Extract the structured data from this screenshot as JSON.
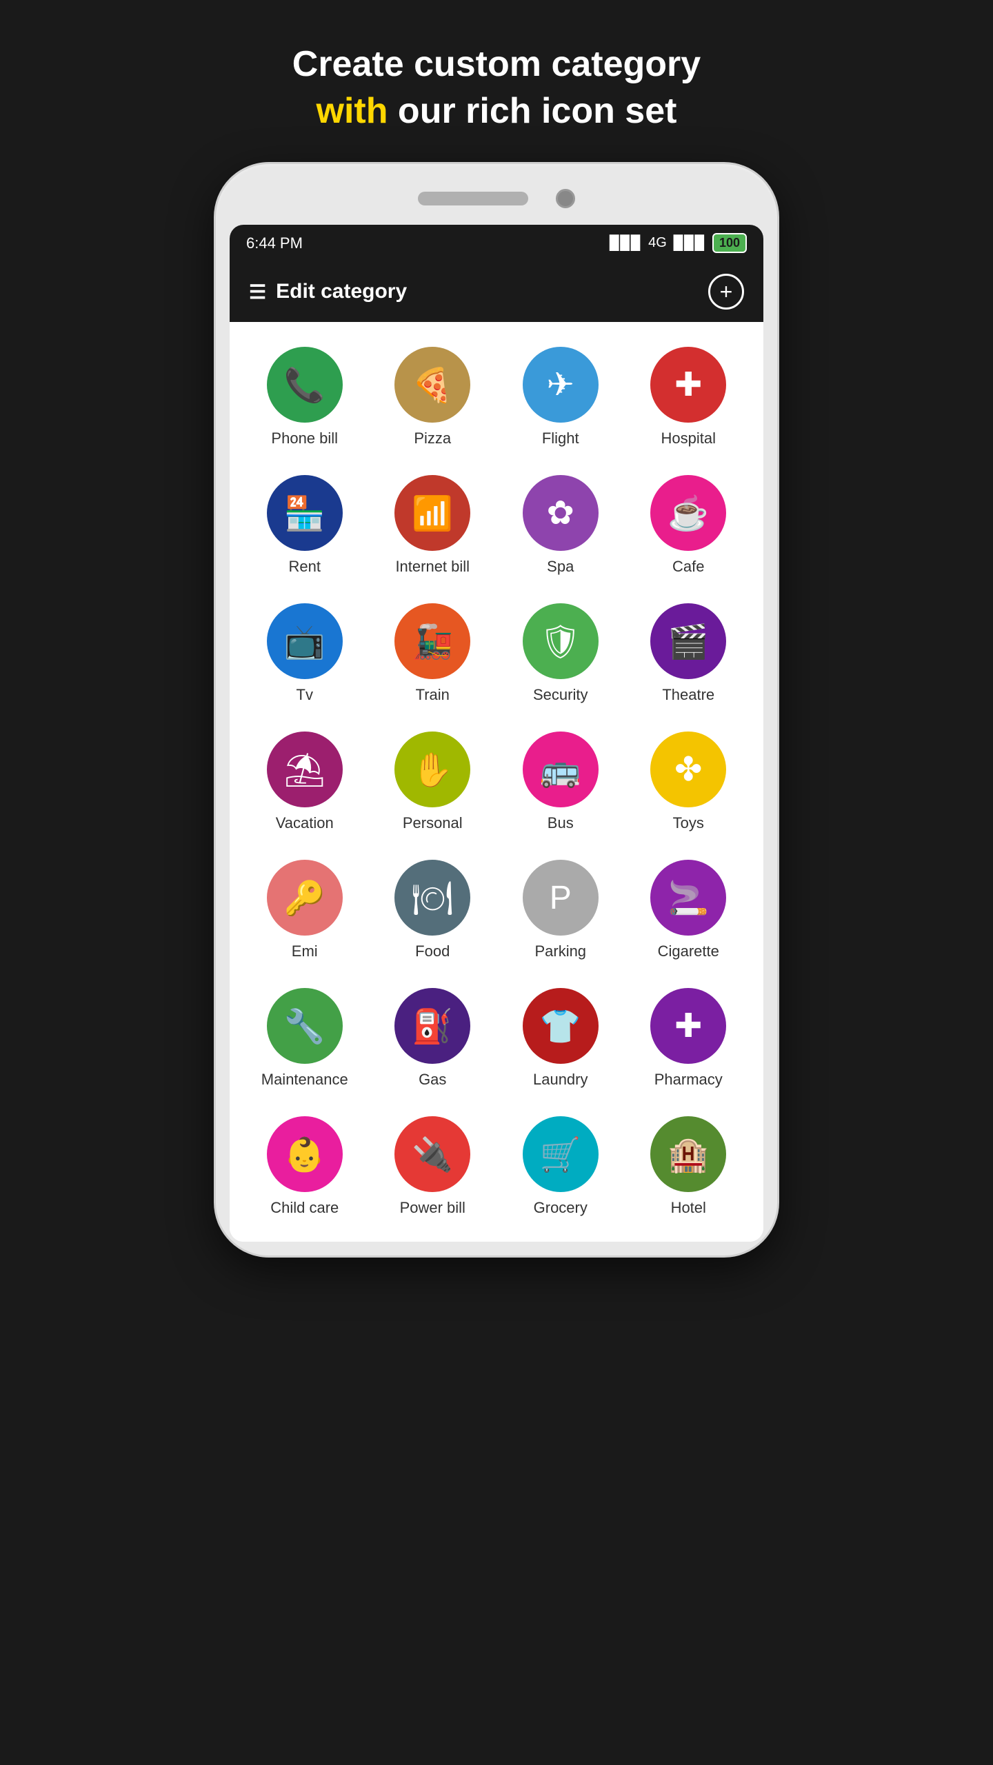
{
  "header": {
    "line1": "Create custom category",
    "with_word": "with",
    "line2": " our rich icon set"
  },
  "status_bar": {
    "time": "6:44 PM",
    "signal": "▉▉▉",
    "network": "4G",
    "battery": "100"
  },
  "app_bar": {
    "title": "Edit category"
  },
  "categories": [
    {
      "label": "Phone bill",
      "icon": "📞",
      "color": "#2e9e4f"
    },
    {
      "label": "Pizza",
      "icon": "🍕",
      "color": "#b8934a"
    },
    {
      "label": "Flight",
      "icon": "✈️",
      "color": "#3a9ad9"
    },
    {
      "label": "Hospital",
      "icon": "🏥",
      "color": "#d32f2f"
    },
    {
      "label": "Rent",
      "icon": "🏪",
      "color": "#1a3a8f"
    },
    {
      "label": "Internet bill",
      "icon": "📡",
      "color": "#c0392b"
    },
    {
      "label": "Spa",
      "icon": "💆",
      "color": "#8e44ad"
    },
    {
      "label": "Cafe",
      "icon": "☕",
      "color": "#e91e8c"
    },
    {
      "label": "Tv",
      "icon": "📺",
      "color": "#1976d2"
    },
    {
      "label": "Train",
      "icon": "🚂",
      "color": "#e65722"
    },
    {
      "label": "Security",
      "icon": "🛡️",
      "color": "#4caf50"
    },
    {
      "label": "Theatre",
      "icon": "🎬",
      "color": "#6a1b9a"
    },
    {
      "label": "Vacation",
      "icon": "⛱️",
      "color": "#9c1f6e"
    },
    {
      "label": "Personal",
      "icon": "✋",
      "color": "#a0b800"
    },
    {
      "label": "Bus",
      "icon": "🚌",
      "color": "#e91e8c"
    },
    {
      "label": "Toys",
      "icon": "🎡",
      "color": "#f4c400"
    },
    {
      "label": "Emi",
      "icon": "🔑",
      "color": "#e57373"
    },
    {
      "label": "Food",
      "icon": "🍽️",
      "color": "#546e7a"
    },
    {
      "label": "Parking",
      "icon": "🅿️",
      "color": "#aaa"
    },
    {
      "label": "Cigarette",
      "icon": "🚬",
      "color": "#8e24aa"
    },
    {
      "label": "Maintenance",
      "icon": "🔧",
      "color": "#43a047"
    },
    {
      "label": "Gas",
      "icon": "⛽",
      "color": "#4a2080"
    },
    {
      "label": "Laundry",
      "icon": "👕",
      "color": "#b71c1c"
    },
    {
      "label": "Pharmacy",
      "icon": "💊",
      "color": "#7b1fa2"
    },
    {
      "label": "Child care",
      "icon": "👶",
      "color": "#e91e9e"
    },
    {
      "label": "Power bill",
      "icon": "🔌",
      "color": "#e53935"
    },
    {
      "label": "Grocery",
      "icon": "🛒",
      "color": "#00acc1"
    },
    {
      "label": "Hotel",
      "icon": "🏨",
      "color": "#558b2f"
    }
  ]
}
